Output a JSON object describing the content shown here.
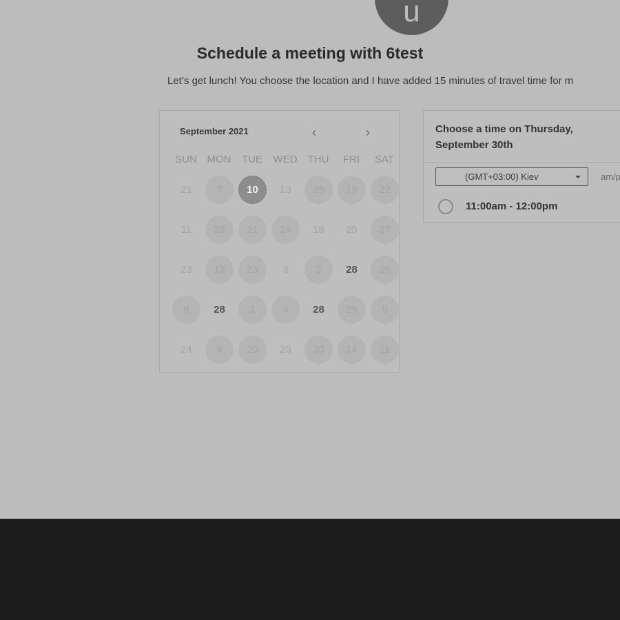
{
  "avatar": {
    "initial": "u"
  },
  "header": {
    "title": "Schedule a meeting with 6test",
    "description": "Let’s get lunch! You choose the location and I have added 15 minutes of travel time for m"
  },
  "calendar": {
    "month_label": "September 2021",
    "prev_icon": "‹",
    "next_icon": "›",
    "weekdays": [
      "SUN",
      "MON",
      "TUE",
      "WED",
      "THU",
      "FRI",
      "SAT"
    ],
    "days": [
      {
        "label": "21",
        "state": "plain"
      },
      {
        "label": "7",
        "state": "avail"
      },
      {
        "label": "10",
        "state": "selected"
      },
      {
        "label": "13",
        "state": "plain"
      },
      {
        "label": "26",
        "state": "avail"
      },
      {
        "label": "19",
        "state": "avail"
      },
      {
        "label": "22",
        "state": "avail"
      },
      {
        "label": "11",
        "state": "plain"
      },
      {
        "label": "28",
        "state": "avail"
      },
      {
        "label": "21",
        "state": "avail"
      },
      {
        "label": "24",
        "state": "avail"
      },
      {
        "label": "18",
        "state": "plain"
      },
      {
        "label": "25",
        "state": "plain"
      },
      {
        "label": "27",
        "state": "avail"
      },
      {
        "label": "23",
        "state": "plain"
      },
      {
        "label": "13",
        "state": "avail"
      },
      {
        "label": "23",
        "state": "avail"
      },
      {
        "label": "3",
        "state": "plain"
      },
      {
        "label": "2",
        "state": "avail"
      },
      {
        "label": "28",
        "state": "bold"
      },
      {
        "label": "25",
        "state": "avail"
      },
      {
        "label": "8",
        "state": "avail"
      },
      {
        "label": "28",
        "state": "bold"
      },
      {
        "label": "1",
        "state": "avail"
      },
      {
        "label": "4",
        "state": "avail"
      },
      {
        "label": "28",
        "state": "bold"
      },
      {
        "label": "29",
        "state": "avail"
      },
      {
        "label": "5",
        "state": "avail"
      },
      {
        "label": "24",
        "state": "plain"
      },
      {
        "label": "9",
        "state": "avail"
      },
      {
        "label": "20",
        "state": "avail"
      },
      {
        "label": "25",
        "state": "plain"
      },
      {
        "label": "30",
        "state": "avail"
      },
      {
        "label": "14",
        "state": "avail"
      },
      {
        "label": "11",
        "state": "avail"
      }
    ]
  },
  "time_panel": {
    "heading": "Choose a time on Thursday, September 30th",
    "timezone": "(GMT+03:00) Kiev",
    "ampm_label": "am/p",
    "slots": [
      {
        "label": "11:00am - 12:00pm"
      }
    ]
  }
}
